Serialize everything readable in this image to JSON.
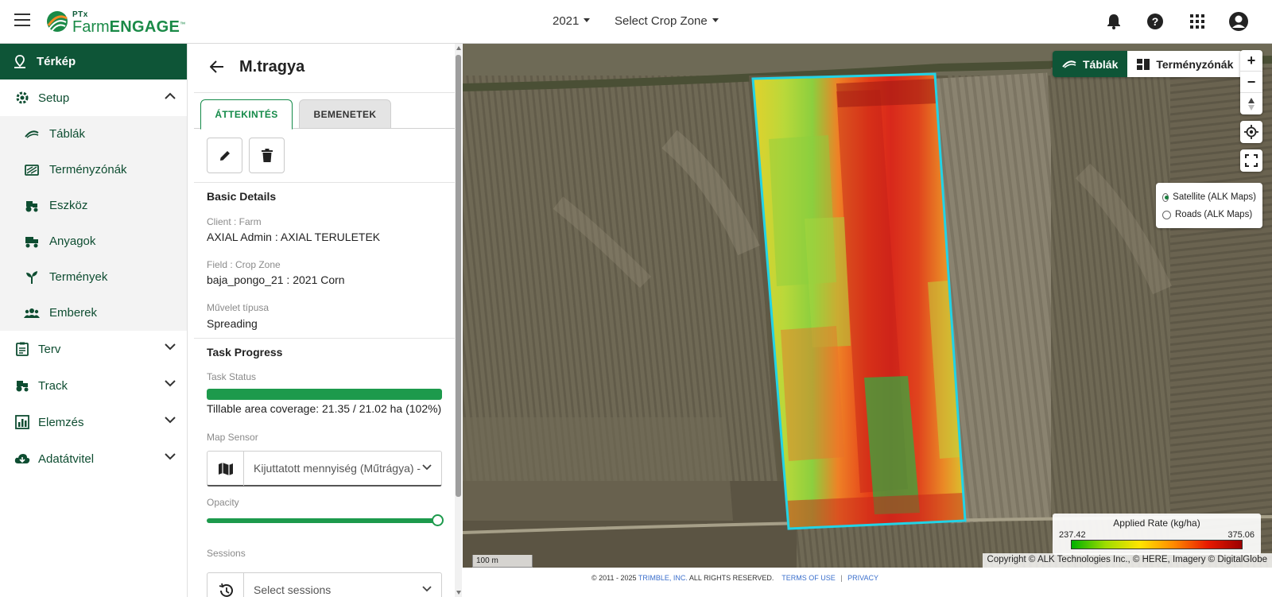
{
  "header": {
    "logo_ptx": "PTx",
    "logo_farm": "Farm",
    "logo_engage": "ENGAGE",
    "logo_tm": "™",
    "year": "2021",
    "crop_zone": "Select Crop Zone"
  },
  "sidebar": {
    "top_item": "Térkép",
    "setup": "Setup",
    "setup_items": [
      "Táblák",
      "Terményzónák",
      "Eszköz",
      "Anyagok",
      "Termények",
      "Emberek"
    ],
    "terv": "Terv",
    "track": "Track",
    "elemzes": "Elemzés",
    "adatatvitel": "Adatátvitel"
  },
  "panel": {
    "title": "M.tragya",
    "tab_overview": "ÁTTEKINTÉS",
    "tab_inputs": "BEMENETEK",
    "basic_details": "Basic Details",
    "client_label": "Client : Farm",
    "client_value": "AXIAL Admin : AXIAL TERULETEK",
    "field_label": "Field : Crop Zone",
    "field_value": "baja_pongo_21 : 2021 Corn",
    "op_label": "Művelet típusa",
    "op_value": "Spreading",
    "task_progress": "Task Progress",
    "task_status_label": "Task Status",
    "task_status_fraction": 1.0,
    "coverage_text": "Tillable area coverage: 21.35 / 21.02 ha (102%)",
    "map_sensor_label": "Map Sensor",
    "map_sensor_value": "Kijuttatott mennyiség (Műtrágya) - kg/ha",
    "opacity_label": "Opacity",
    "opacity_fraction": 1.0,
    "sessions_label": "Sessions",
    "sessions_placeholder": "Select sessions"
  },
  "map": {
    "toggle_fields": "Táblák",
    "toggle_cropzones": "Terményzónák",
    "zoom_in": "+",
    "zoom_out": "−",
    "layer_satellite": "Satellite (ALK Maps)",
    "layer_roads": "Roads (ALK Maps)",
    "legend_title": "Applied Rate (kg/ha)",
    "legend_min": "237.42",
    "legend_max": "375.06",
    "scale_label": "100 m",
    "copyright": "Copyright © ALK Technologies Inc., © HERE, Imagery © DigitalGlobe",
    "footer_copy": "© 2011 - 2025",
    "footer_trimble": "TRIMBLE, INC.",
    "footer_rights": "ALL RIGHTS RESERVED.",
    "footer_terms": "TERMS OF USE",
    "footer_sep": "|",
    "footer_privacy": "PRIVACY"
  },
  "colors": {
    "brand_dark": "#0e5537",
    "brand_green": "#1d9a4c",
    "field_outline": "#22d3e6"
  },
  "icons": [
    "menu-icon",
    "bell-icon",
    "help-icon",
    "apps-grid-icon",
    "account-icon",
    "map-pin-icon",
    "back-arrow-icon",
    "pencil-icon",
    "trash-icon",
    "map-icon",
    "history-icon",
    "locate-icon",
    "fullscreen-icon",
    "compass-icon"
  ]
}
